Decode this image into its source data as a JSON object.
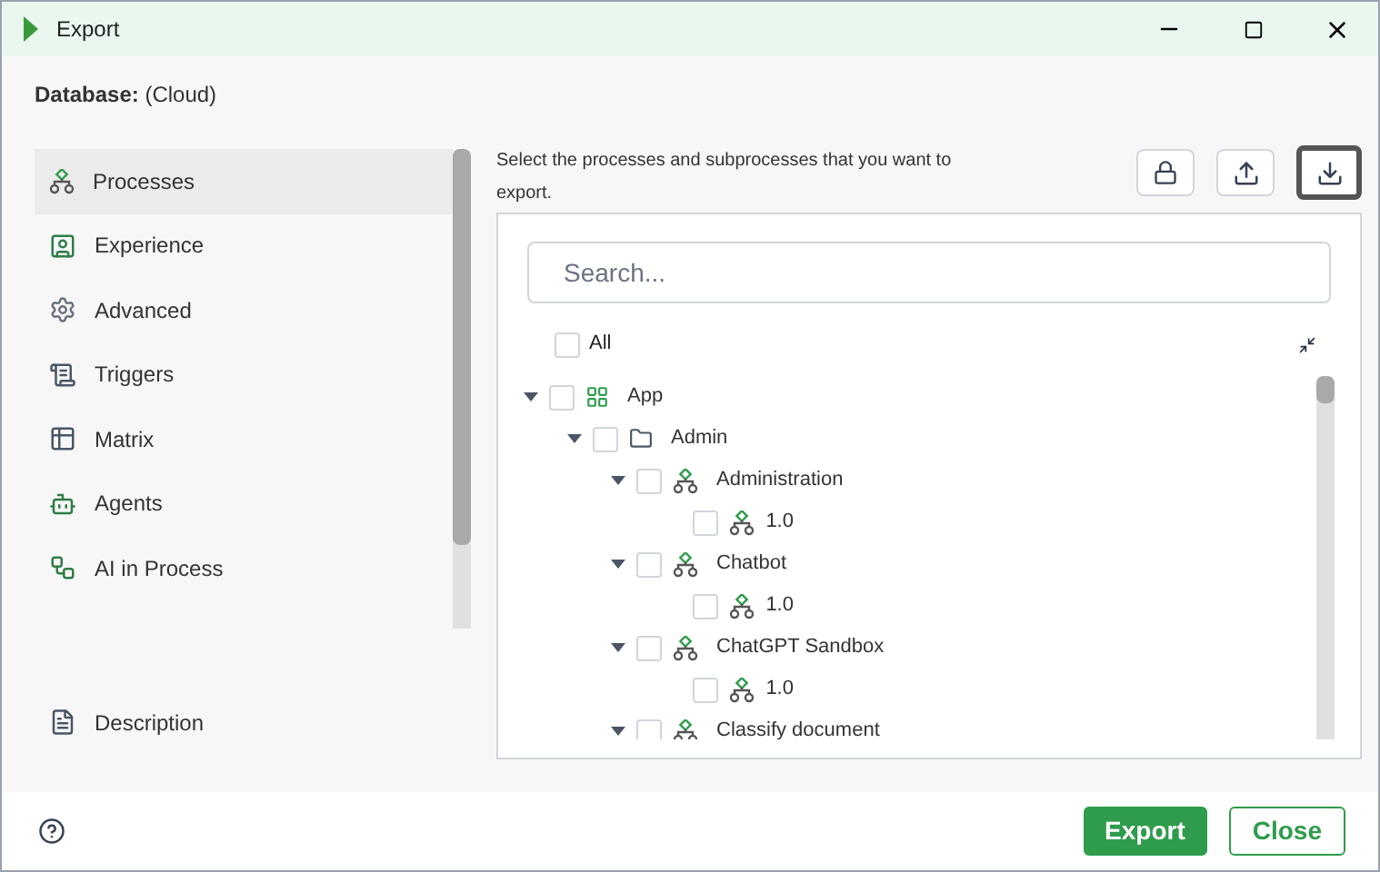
{
  "window": {
    "title": "Export"
  },
  "database": {
    "label": "Database:",
    "value": "(Cloud)"
  },
  "sidebar": {
    "items": [
      {
        "label": "Processes",
        "kind": "processes",
        "selected": true
      },
      {
        "label": "Experience",
        "kind": "experience",
        "selected": false
      },
      {
        "label": "Advanced",
        "kind": "advanced",
        "selected": false
      },
      {
        "label": "Triggers",
        "kind": "triggers",
        "selected": false
      },
      {
        "label": "Matrix",
        "kind": "matrix",
        "selected": false
      },
      {
        "label": "Agents",
        "kind": "agents",
        "selected": false
      },
      {
        "label": "AI in Process",
        "kind": "ai",
        "selected": false
      }
    ],
    "footer_item": {
      "label": "Description"
    }
  },
  "instructions": "Select the processes and subprocesses that you want to export.",
  "search": {
    "placeholder": "Search..."
  },
  "all": {
    "label": "All",
    "checked": false
  },
  "tree": [
    {
      "label": "App",
      "kind": "app",
      "checked": false,
      "expanded": true,
      "children": [
        {
          "label": "Admin",
          "kind": "folder",
          "checked": false,
          "expanded": true,
          "children": [
            {
              "label": "Administration",
              "kind": "process",
              "checked": false,
              "expanded": true,
              "children": [
                {
                  "label": "1.0",
                  "kind": "version",
                  "checked": false
                }
              ]
            },
            {
              "label": "Chatbot",
              "kind": "process",
              "checked": false,
              "expanded": true,
              "children": [
                {
                  "label": "1.0",
                  "kind": "version",
                  "checked": false
                }
              ]
            },
            {
              "label": "ChatGPT Sandbox",
              "kind": "process",
              "checked": false,
              "expanded": true,
              "children": [
                {
                  "label": "1.0",
                  "kind": "version",
                  "checked": false
                }
              ]
            },
            {
              "label": "Classify document",
              "kind": "process",
              "checked": false,
              "expanded": true
            }
          ]
        }
      ]
    }
  ],
  "buttons": {
    "primary": "Export",
    "secondary": "Close"
  }
}
